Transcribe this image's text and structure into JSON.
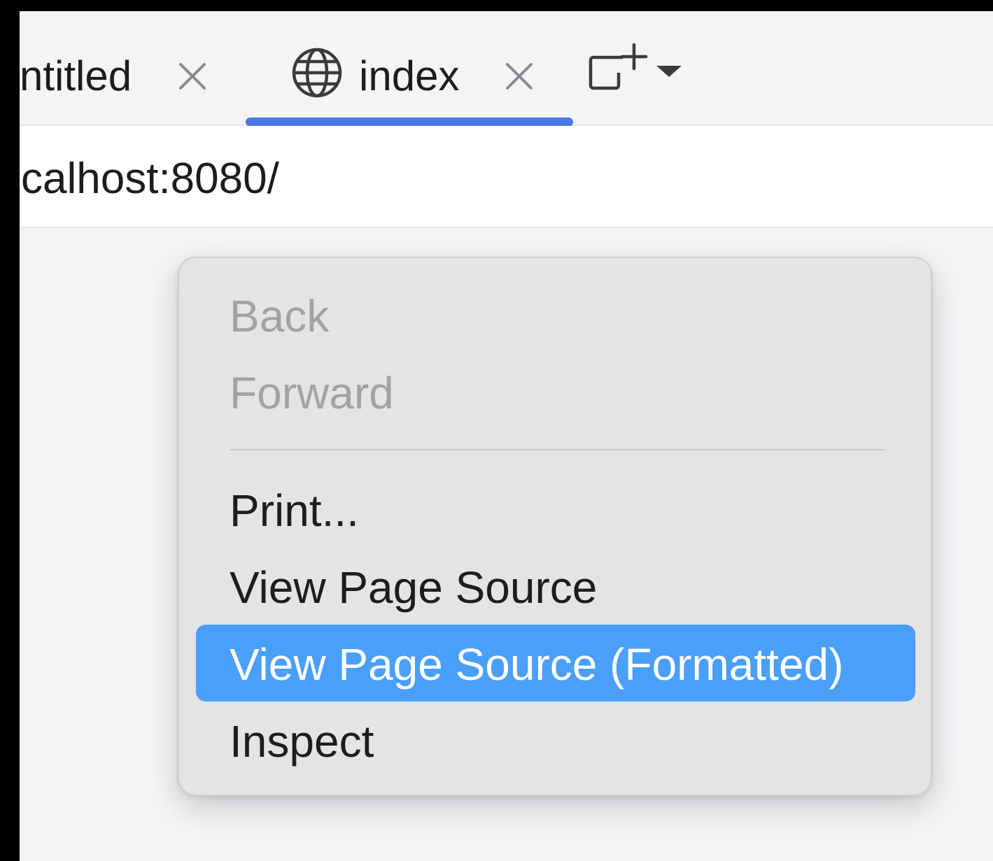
{
  "tabs": [
    {
      "label": "ntitled",
      "active": false
    },
    {
      "label": "index",
      "active": true
    }
  ],
  "toolbar": {
    "new_tab_icon": "new-tab-icon",
    "accent_color": "#4a78e6"
  },
  "address_bar": {
    "url": "calhost:8080/"
  },
  "context_menu": {
    "items": [
      {
        "label": "Back",
        "enabled": false
      },
      {
        "label": "Forward",
        "enabled": false
      },
      {
        "label": "Print...",
        "enabled": true
      },
      {
        "label": "View Page Source",
        "enabled": true
      },
      {
        "label": "View Page Source (Formatted)",
        "enabled": true,
        "highlighted": true
      },
      {
        "label": "Inspect",
        "enabled": true
      }
    ],
    "highlight_color": "#4a9ff8"
  }
}
